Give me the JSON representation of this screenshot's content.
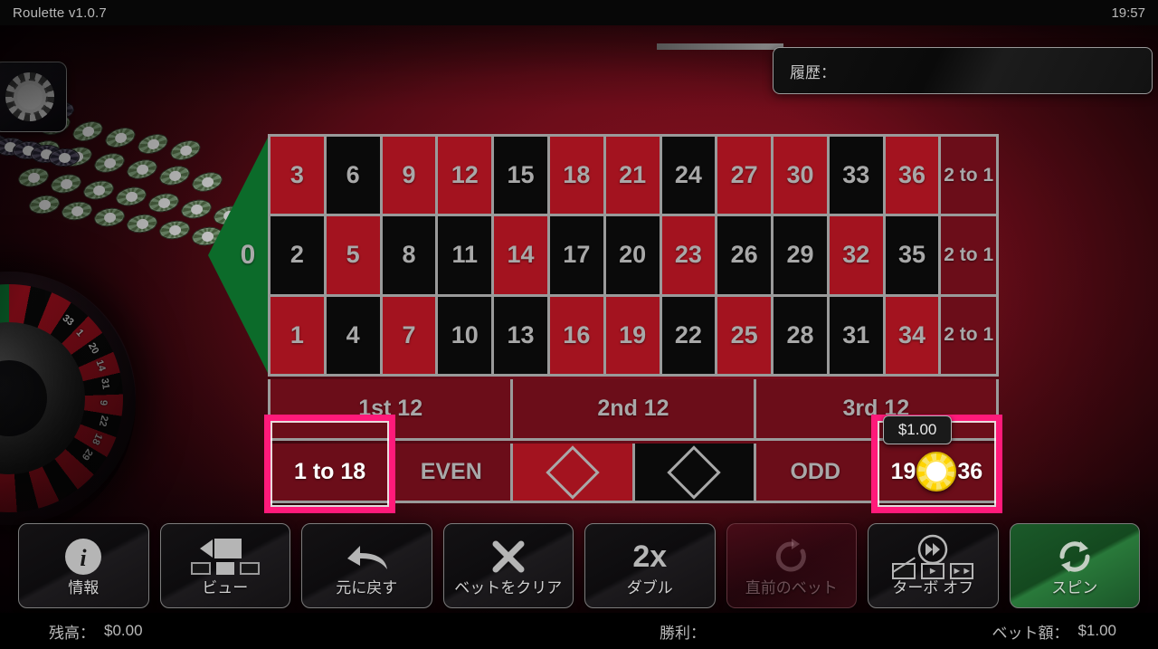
{
  "titlebar": {
    "title": "Roulette v1.0.7",
    "clock": "19:57"
  },
  "history": {
    "label": "履歴："
  },
  "table": {
    "zero": "0",
    "column_bet_label": "2 to 1",
    "rows": [
      [
        {
          "n": "3",
          "c": "red"
        },
        {
          "n": "6",
          "c": "black"
        },
        {
          "n": "9",
          "c": "red"
        },
        {
          "n": "12",
          "c": "red"
        },
        {
          "n": "15",
          "c": "black"
        },
        {
          "n": "18",
          "c": "red"
        },
        {
          "n": "21",
          "c": "red"
        },
        {
          "n": "24",
          "c": "black"
        },
        {
          "n": "27",
          "c": "red"
        },
        {
          "n": "30",
          "c": "red"
        },
        {
          "n": "33",
          "c": "black"
        },
        {
          "n": "36",
          "c": "red"
        }
      ],
      [
        {
          "n": "2",
          "c": "black"
        },
        {
          "n": "5",
          "c": "red"
        },
        {
          "n": "8",
          "c": "black"
        },
        {
          "n": "11",
          "c": "black"
        },
        {
          "n": "14",
          "c": "red"
        },
        {
          "n": "17",
          "c": "black"
        },
        {
          "n": "20",
          "c": "black"
        },
        {
          "n": "23",
          "c": "red"
        },
        {
          "n": "26",
          "c": "black"
        },
        {
          "n": "29",
          "c": "black"
        },
        {
          "n": "32",
          "c": "red"
        },
        {
          "n": "35",
          "c": "black"
        }
      ],
      [
        {
          "n": "1",
          "c": "red"
        },
        {
          "n": "4",
          "c": "black"
        },
        {
          "n": "7",
          "c": "red"
        },
        {
          "n": "10",
          "c": "black"
        },
        {
          "n": "13",
          "c": "black"
        },
        {
          "n": "16",
          "c": "red"
        },
        {
          "n": "19",
          "c": "red"
        },
        {
          "n": "22",
          "c": "black"
        },
        {
          "n": "25",
          "c": "red"
        },
        {
          "n": "28",
          "c": "black"
        },
        {
          "n": "31",
          "c": "black"
        },
        {
          "n": "34",
          "c": "red"
        }
      ]
    ],
    "dozens": [
      "1st 12",
      "2nd 12",
      "3rd 12"
    ],
    "outside": [
      {
        "label": "1 to 18",
        "kind": "text",
        "selected": true
      },
      {
        "label": "EVEN",
        "kind": "text",
        "selected": false
      },
      {
        "label": "RED",
        "kind": "diamond-red",
        "selected": false
      },
      {
        "label": "BLACK",
        "kind": "diamond-black",
        "selected": false
      },
      {
        "label": "ODD",
        "kind": "text",
        "selected": false
      },
      {
        "label": "19 to 36",
        "kind": "split",
        "selected": true,
        "left": "19",
        "right": "36"
      }
    ],
    "active_bet": {
      "cell": "19 to 36",
      "amount": "$1.00",
      "chip_color": "#ffd400"
    },
    "highlight_color": "#ff1a7a"
  },
  "wheel": {
    "numbers": [
      "33",
      "1",
      "20",
      "14",
      "31",
      "9",
      "22",
      "18",
      "29"
    ]
  },
  "toolbar": [
    {
      "id": "info",
      "label": "情報",
      "icon": "info-icon",
      "state": "enabled"
    },
    {
      "id": "view",
      "label": "ビュー",
      "icon": "view-icon",
      "state": "enabled"
    },
    {
      "id": "undo",
      "label": "元に戻す",
      "icon": "undo-arrow-icon",
      "state": "enabled"
    },
    {
      "id": "clear",
      "label": "ベットをクリア",
      "icon": "x-icon",
      "state": "enabled"
    },
    {
      "id": "double",
      "label": "ダブル",
      "icon": "2x-icon",
      "state": "enabled",
      "icon_text": "2x"
    },
    {
      "id": "last-bet",
      "label": "直前のベット",
      "icon": "rebet-icon",
      "state": "disabled"
    },
    {
      "id": "turbo",
      "label": "ターボ オフ",
      "icon": "turbo-icon",
      "state": "enabled"
    },
    {
      "id": "spin",
      "label": "スピン",
      "icon": "spin-icon",
      "state": "primary"
    }
  ],
  "statusbar": {
    "balance_label": "残高：",
    "balance_value": "$0.00",
    "win_label": "勝利：",
    "win_value": "",
    "bet_label": "ベット額：",
    "bet_value": "$1.00"
  }
}
